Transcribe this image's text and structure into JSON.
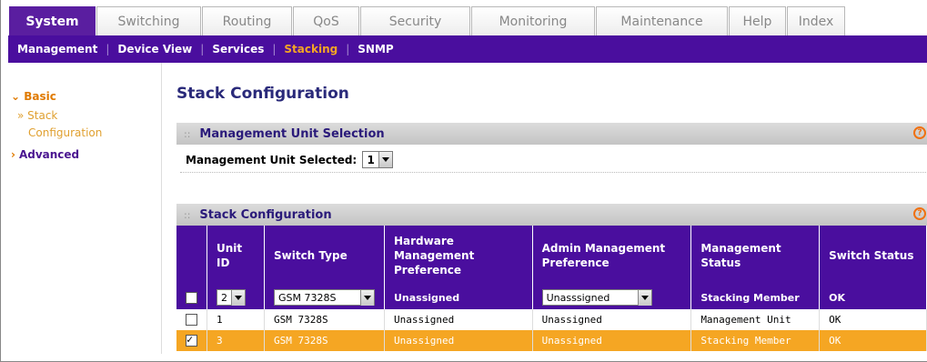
{
  "tabs": [
    "System",
    "Switching",
    "Routing",
    "QoS",
    "Security",
    "Monitoring",
    "Maintenance",
    "Help",
    "Index"
  ],
  "active_tab": "System",
  "subnav": [
    "Management",
    "Device View",
    "Services",
    "Stacking",
    "SNMP"
  ],
  "active_subnav": "Stacking",
  "leftnav": {
    "basic": "Basic",
    "stack_line1": "» Stack",
    "stack_line2": "Configuration",
    "advanced": "Advanced"
  },
  "page_title": "Stack Configuration",
  "mus": {
    "header": "Management Unit Selection",
    "label": "Management Unit Selected:",
    "value": "1"
  },
  "stack": {
    "header": "Stack Configuration",
    "columns": [
      "Unit ID",
      "Switch Type",
      "Hardware Management Preference",
      "Admin Management Preference",
      "Management Status",
      "Switch Status"
    ],
    "edit_row": {
      "unit": "2",
      "type": "GSM 7328S",
      "hw": "Unassigned",
      "admin": "Unasssigned",
      "mgmt": "Stacking Member",
      "status": "OK"
    },
    "rows": [
      {
        "checked": false,
        "unit": "1",
        "type": "GSM 7328S",
        "hw": "Unassigned",
        "admin": "Unassigned",
        "mgmt": "Management Unit",
        "status": "OK"
      },
      {
        "checked": true,
        "unit": "3",
        "type": "GSM 7328S",
        "hw": "Unassigned",
        "admin": "Unassigned",
        "mgmt": "Stacking Member",
        "status": "OK"
      }
    ]
  },
  "colors": {
    "purple": "#4a0e9e",
    "orange": "#f5a623"
  }
}
